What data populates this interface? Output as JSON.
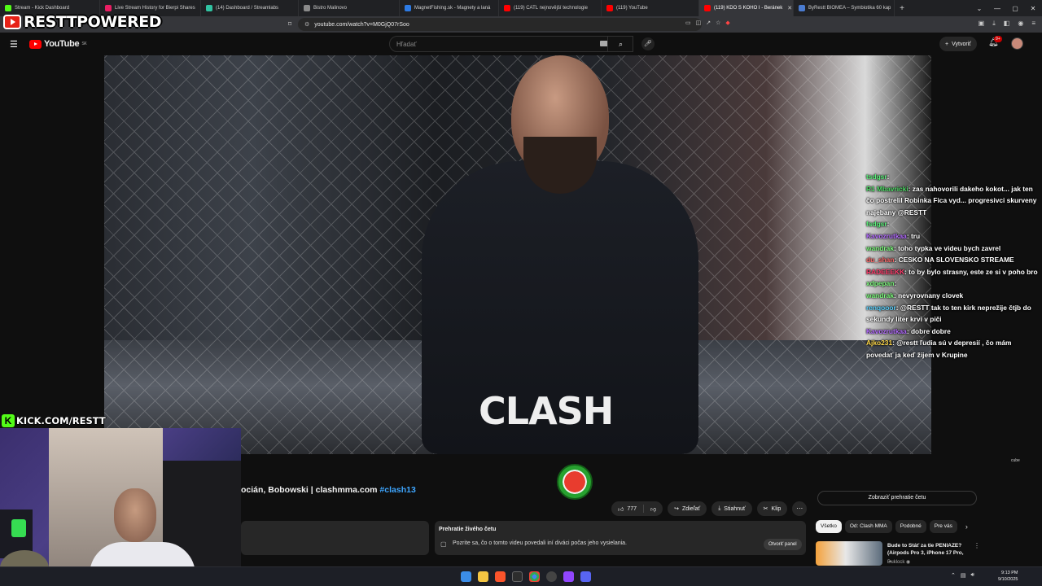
{
  "browser": {
    "tabs": [
      {
        "label": "Stream - Kick Dashboard",
        "color": "#53fc18"
      },
      {
        "label": "Live Stream History for Bierpi Shares",
        "color": "#e91e63"
      },
      {
        "label": "(14) Dashboard / Streamlabs",
        "color": "#31c3a2"
      },
      {
        "label": "Bistro Malinovo",
        "color": "#8a8a8a"
      },
      {
        "label": "MagnetFishing.sk - Magnety a laná",
        "color": "#2d7be5"
      },
      {
        "label": "(119) CATL nejnovější technologie",
        "color": "#ff0000"
      },
      {
        "label": "(119) YouTube",
        "color": "#ff0000"
      },
      {
        "label": "(119) KDO S KOHO I - Beránek",
        "color": "#ff0000"
      },
      {
        "label": "ByRestt BIOMEA – Symbiotika 60 kap",
        "color": "#4a7bd0"
      }
    ],
    "active_tab": 7,
    "url": "youtube.com/watch?v=M0GjQ07rSoo",
    "new_tab": "+",
    "window_controls": [
      "⌄",
      "—",
      "▢",
      "✕"
    ]
  },
  "youtube": {
    "logo": "YouTube",
    "region": "SK",
    "search_placeholder": "Hľadať",
    "create_label": "Vytvoriť",
    "notif_count": "9+",
    "video_watermark": "cube",
    "title_prefix": "ocián, Bobowski | clashmma.com",
    "title_tag": "#clash13",
    "like_count": "777",
    "share_label": "Zdieľať",
    "download_label": "Stiahnuť",
    "clip_label": "Klip",
    "more": "⋯",
    "chat_replay_title": "Prehratie živého četu",
    "chat_replay_desc": "Pozrite sa, čo o tomto videu povedali iní diváci počas jeho vysielania.",
    "open_panel": "Otvoriť panel",
    "show_chat_replay": "Zobraziť prehratie četu",
    "chips": [
      "Všetko",
      "Od: Clash MMA",
      "Podobné",
      "Pre vás"
    ],
    "reco": {
      "title": "Bude to Stáť za tie PENIAZE? (Airpods Pro 3, iPhone 17 Pro, ...",
      "channel": "Duklock"
    }
  },
  "overlay": {
    "brand": "RESTTPOWERED",
    "kick": "KICK.COM/RESTT",
    "chat": [
      {
        "user": "tsdgsr",
        "color": "#5af27a",
        "msg": ""
      },
      {
        "user": "R1 Mbavricki",
        "color": "#4cd964",
        "msg": "zas nahovorili dakeho kokot... jak ten čo postrelil Robinka Fica vyd... progresivci skurveny najebany @RESTT"
      },
      {
        "user": "fsdgsr",
        "color": "#5af27a",
        "msg": ""
      },
      {
        "user": "Kavozrutkaa",
        "color": "#b36bff",
        "msg": "tru"
      },
      {
        "user": "wandrak",
        "color": "#7cfc7c",
        "msg": "toho typka ve videu bych zavrel"
      },
      {
        "user": "du_shan",
        "color": "#ff6b6b",
        "msg": "CESKO NA SLOVENSKO STREAME"
      },
      {
        "user": "RADEEEKK",
        "color": "#ff3b6b",
        "msg": "to by bylo strasny, este ze si v poho bro"
      },
      {
        "user": "xdpepan",
        "color": "#7cfc7c",
        "msg": ""
      },
      {
        "user": "wandrak",
        "color": "#7cfc7c",
        "msg": "nevyrovnany clovek"
      },
      {
        "user": "renqooor",
        "color": "#5ad2ff",
        "msg": "@RESTT tak to ten kirk neprežije čtjb do sekundy liter krvi v piči"
      },
      {
        "user": "Kavozrutkaa",
        "color": "#b36bff",
        "msg": "dobre dobre"
      },
      {
        "user": "Ajko231",
        "color": "#ffd84a",
        "msg": "@restt ľudia sú v depresií , čo mám povedať ja keď žijem v Krupine"
      }
    ]
  },
  "video_scene": {
    "jersey_text": "CLASH"
  },
  "system": {
    "time": "9:13 PM",
    "date": "9/10/2025"
  }
}
